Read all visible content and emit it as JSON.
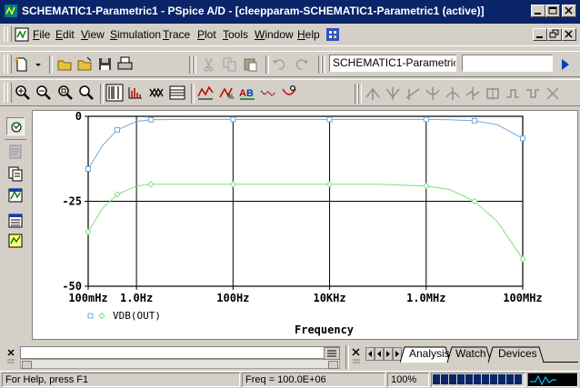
{
  "window": {
    "title": "SCHEMATIC1-Parametric1 - PSpice A/D - [cleepparam-SCHEMATIC1-Parametric1 (active)]"
  },
  "menubar": {
    "items": [
      {
        "label": "File",
        "u": "F",
        "rest": "ile"
      },
      {
        "label": "Edit",
        "u": "E",
        "rest": "dit"
      },
      {
        "label": "View",
        "u": "V",
        "rest": "iew"
      },
      {
        "label": "Simulation",
        "u": "S",
        "rest": "imulation"
      },
      {
        "label": "Trace",
        "u": "T",
        "rest": "race"
      },
      {
        "label": "Plot",
        "u": "P",
        "rest": "lot"
      },
      {
        "label": "Tools",
        "u": "T",
        "rest": "ools"
      },
      {
        "label": "Window",
        "u": "W",
        "rest": "indow"
      },
      {
        "label": "Help",
        "u": "H",
        "rest": "elp"
      }
    ]
  },
  "toolbar": {
    "profile_select": "SCHEMATIC1-Parametric1",
    "search_value": ""
  },
  "plot": {
    "xlabel": "Frequency",
    "legend_label": "VDB(OUT)",
    "colors": {
      "series1": "#6fa8dc",
      "series2": "#7ee07e",
      "grid": "#000000"
    }
  },
  "chart_data": {
    "type": "line",
    "x_scale": "log",
    "xlim": [
      0.1,
      100000000
    ],
    "ylim": [
      -50,
      0
    ],
    "x_ticks": [
      {
        "value": 0.1,
        "label": "100mHz"
      },
      {
        "value": 1,
        "label": "1.0Hz"
      },
      {
        "value": 100,
        "label": "100Hz"
      },
      {
        "value": 10000,
        "label": "10KHz"
      },
      {
        "value": 1000000,
        "label": "1.0MHz"
      },
      {
        "value": 100000000,
        "label": "100MHz"
      }
    ],
    "y_ticks": [
      {
        "value": 0,
        "label": "0"
      },
      {
        "value": -25,
        "label": "-25"
      },
      {
        "value": -50,
        "label": "-50"
      }
    ],
    "legend": "VDB(OUT)",
    "series": [
      {
        "marker": "square",
        "x": [
          0.1,
          0.2,
          0.4,
          1,
          2,
          10,
          100,
          1000,
          10000,
          100000,
          1000000,
          3000000,
          10000000,
          30000000,
          100000000
        ],
        "y": [
          -15.5,
          -8.5,
          -4,
          -1.5,
          -1,
          -0.9,
          -0.9,
          -0.9,
          -0.9,
          -0.9,
          -0.9,
          -1,
          -1.3,
          -2.5,
          -6.5
        ]
      },
      {
        "marker": "diamond",
        "x": [
          0.1,
          0.2,
          0.4,
          1,
          2,
          10,
          100,
          1000,
          10000,
          100000,
          1000000,
          3000000,
          10000000,
          30000000,
          100000000
        ],
        "y": [
          -34,
          -27,
          -23,
          -20.5,
          -20,
          -20,
          -20,
          -20,
          -20,
          -20,
          -20.5,
          -21.5,
          -25,
          -31,
          -42
        ]
      }
    ]
  },
  "command": {
    "tabs": [
      "Analysis",
      "Watch",
      "Devices"
    ]
  },
  "status": {
    "help": "For Help, press F1",
    "freq": "Freq = 100.0E+06",
    "percent": "100%",
    "progress": 1.0
  }
}
